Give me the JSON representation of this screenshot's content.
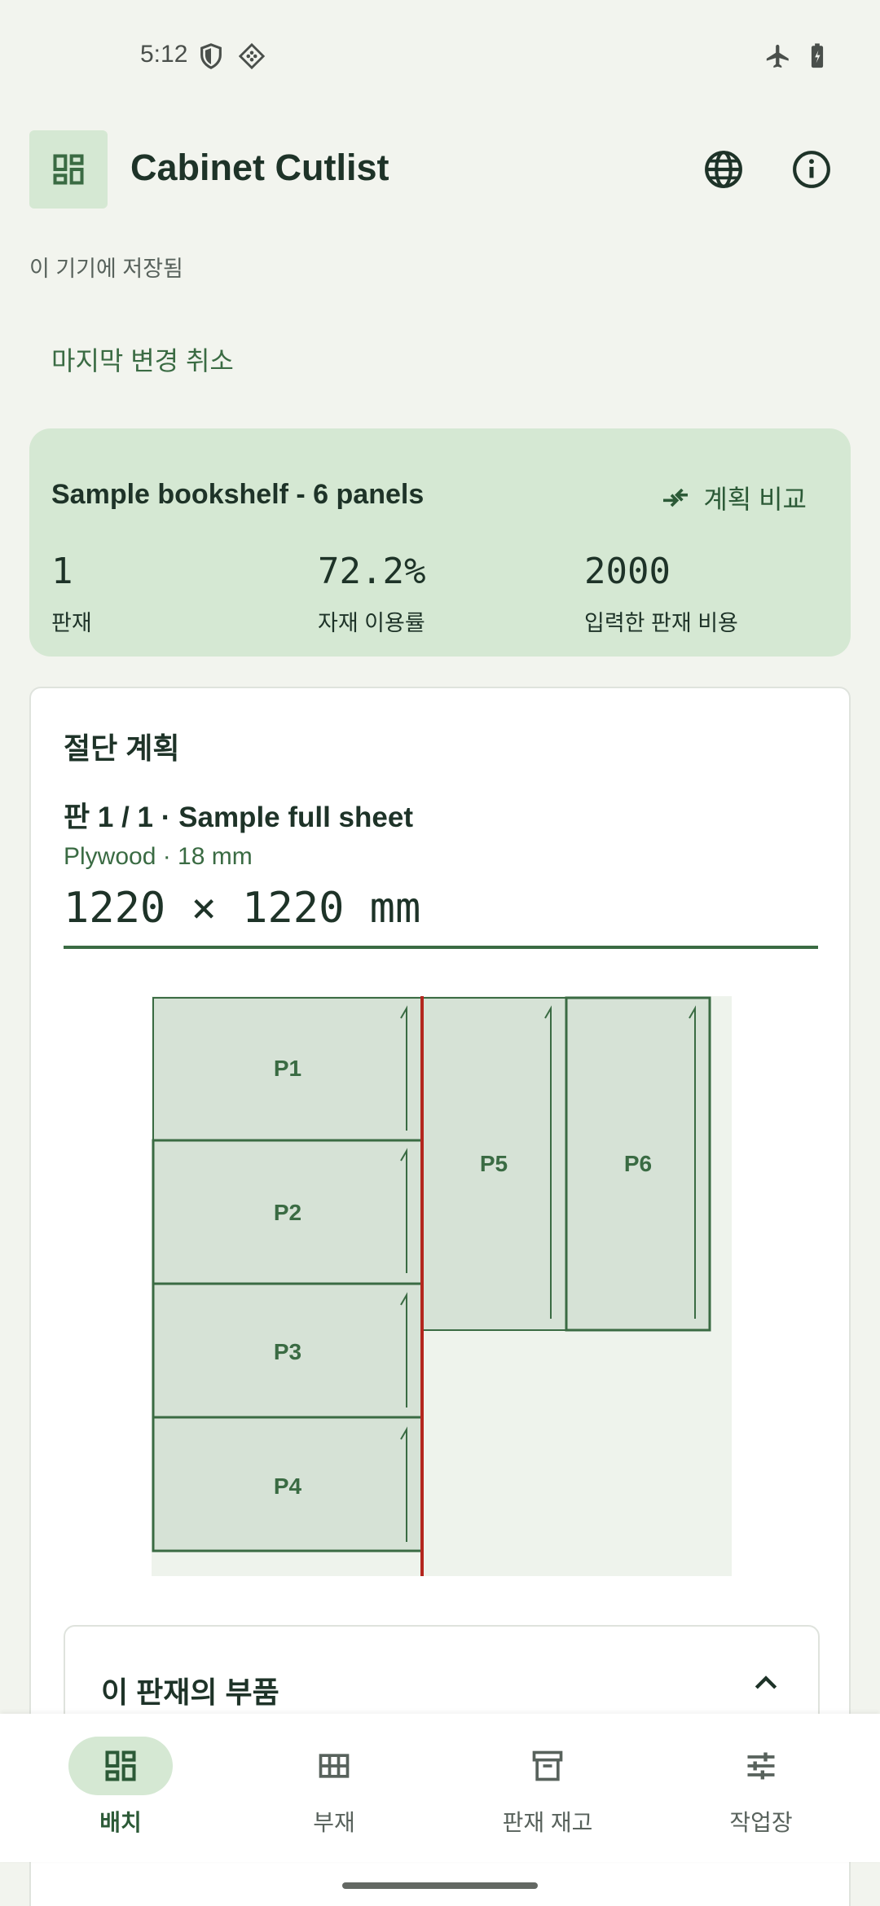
{
  "status_bar": {
    "time": "5:12",
    "icons": [
      "shield-icon",
      "vpn-diamond-icon",
      "airplane-icon",
      "battery-icon"
    ]
  },
  "app_bar": {
    "title": "Cabinet Cutlist",
    "logo_icon": "dashboard-icon",
    "actions": [
      "globe-icon",
      "info-icon"
    ]
  },
  "saved_status": "이 기기에 저장됨",
  "undo_label": "마지막 변경 취소",
  "summary": {
    "project_name": "Sample bookshelf - 6 panels",
    "compare_label": "계획 비교",
    "stats": [
      {
        "value": "1",
        "label": "판재"
      },
      {
        "value": "72.2%",
        "label": "자재 이용률"
      },
      {
        "value": "2000",
        "label": "입력한 판재 비용"
      }
    ]
  },
  "plan": {
    "heading": "절단 계획",
    "sheet_title": "판 1 / 1 · Sample full sheet",
    "sheet_material": "Plywood · 18 mm",
    "sheet_size": "1220 × 1220 mm",
    "panels": [
      "P1",
      "P2",
      "P3",
      "P4",
      "P5",
      "P6"
    ]
  },
  "parts_section": {
    "title": "이 판재의 부품"
  },
  "nav": {
    "items": [
      {
        "label": "배치",
        "icon": "layout-icon",
        "active": true
      },
      {
        "label": "부재",
        "icon": "grid-icon",
        "active": false
      },
      {
        "label": "판재 재고",
        "icon": "archive-icon",
        "active": false
      },
      {
        "label": "작업장",
        "icon": "sliders-icon",
        "active": false
      }
    ]
  },
  "colors": {
    "accent": "#3a6b43",
    "container": "#d5e8d3",
    "background": "#f2f4ee",
    "cut_line": "#b3261e"
  }
}
